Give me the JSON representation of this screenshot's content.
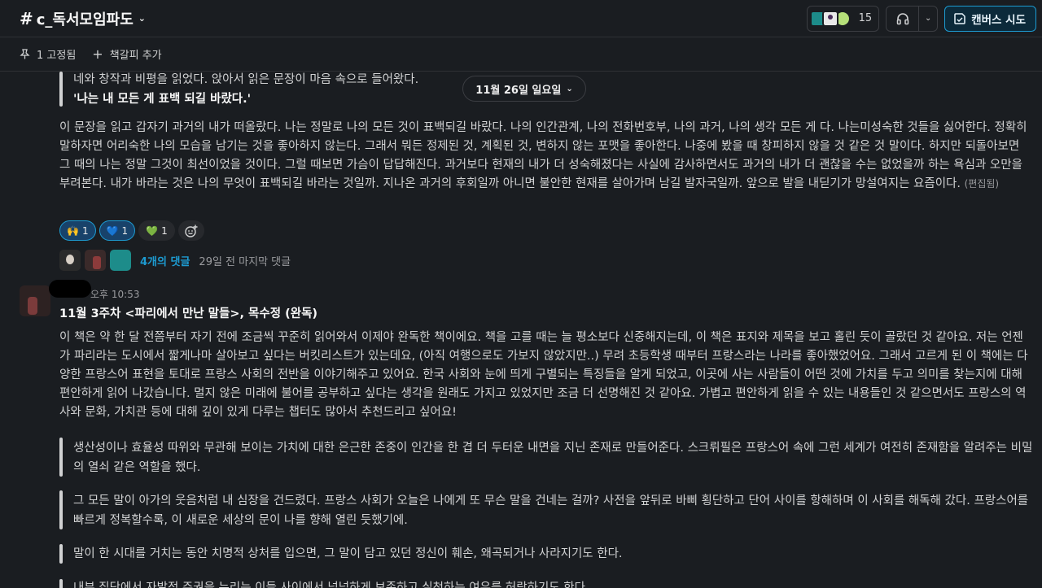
{
  "header": {
    "channel_prefix": "#",
    "channel_name": "c_독서모임파도",
    "member_count": "15",
    "canvas_button": "캔버스 시도"
  },
  "subbar": {
    "pinned": "1 고정됨",
    "add_bookmark": "책갈피 추가"
  },
  "date_divider": "11월 26일 일요일",
  "prev_message": {
    "quote_line1": "네와 창작과 비평을 읽었다. 앉아서 읽은 문장이 마음 속으로 들어왔다.",
    "quote_line2": "'나는 내 모든 게 표백 되길 바랐다.'",
    "body": "이 문장을 읽고 갑자기 과거의 내가 떠올랐다. 나는 정말로 나의 모든 것이 표백되길 바랐다. 나의 인간관계, 나의 전화번호부, 나의 과거, 나의 생각 모든 게 다. 나는미성숙한 것들을 싫어한다. 정확히 말하자면 어리숙한 나의 모습을 남기는 것을 좋아하지 않는다. 그래서 뭐든 정제된 것, 계획된 것, 변하지 않는 포맷을 좋아한다. 나중에 봤을 때 창피하지 않을 것 같은 것 말이다. 하지만 되돌아보면 그 때의 나는 정말 그것이 최선이었을 것이다.  그럴 때보면 가슴이 답답해진다. 과거보다 현재의 내가 더 성숙해졌다는 사실에 감사하면서도 과거의 내가 더 괜찮을 수는 없었을까 하는 욕심과 오만을 부려본다. 내가 바라는 것은 나의 무엇이 표백되길 바라는 것일까. 지나온 과거의 후회일까 아니면 불안한 현재를 살아가며 남길 발자국일까. 앞으로 발을 내딛기가 망설여지는 요즘이다.",
    "edited": "(편집됨)",
    "reactions": [
      {
        "emoji": "🙌",
        "count": "1",
        "selected": true
      },
      {
        "emoji": "💙",
        "count": "1",
        "selected": true
      },
      {
        "emoji": "💚",
        "count": "1",
        "selected": false
      }
    ],
    "thread": {
      "replies": "4개의 댓글",
      "last_reply": "29일 전 마지막 댓글"
    }
  },
  "message": {
    "time": "오후 10:53",
    "title": "11월 3주차 <파리에서 만난 말들>, 목수정 (완독)",
    "body": "이 책은 약 한 달 전쯤부터 자기 전에 조금씩 꾸준히 읽어와서 이제야 완독한 책이에요. 책을 고를 때는 늘 평소보다 신중해지는데, 이 책은 표지와 제목을 보고 홀린 듯이 골랐던 것 같아요. 저는 언젠가 파리라는 도시에서 짧게나마 살아보고 싶다는 버킷리스트가 있는데요, (아직 여행으로도 가보지 않았지만..) 무려 초등학생 때부터 프랑스라는 나라를 좋아했었어요. 그래서 고르게 된 이 책에는 다양한 프랑스어 표현을 토대로 프랑스 사회의 전반을 이야기해주고 있어요. 한국 사회와 눈에 띄게 구별되는 특징들을 알게 되었고, 이곳에 사는 사람들이 어떤 것에 가치를 두고 의미를 찾는지에 대해 편안하게 읽어 나갔습니다. 멀지 않은 미래에 불어를 공부하고 싶다는 생각을 원래도 가지고 있었지만 조금 더 선명해진 것 같아요. 가볍고 편안하게 읽을 수 있는 내용들인 것 같으면서도 프랑스의 역사와 문화, 가치관 등에 대해 깊이 있게 다루는 챕터도 많아서 추천드리고 싶어요!",
    "quotes": [
      "생산성이나 효율성 따위와 무관해 보이는 가치에 대한 은근한 존중이 인간을 한 겹 더 두터운 내면을 지닌 존재로 만들어준다. 스크뤼필은 프랑스어 속에 그런 세계가 여전히 존재함을 알려주는 비밀의 열쇠 같은 역할을 했다.",
      "그 모든 말이 아가의 웃음처럼 내 심장을 건드렸다. 프랑스 사회가 오늘은 나에게 또 무슨 말을 건네는 걸까? 사전을 앞뒤로 바삐 횡단하고 단어 사이를 항해하며 이 사회를 해독해 갔다. 프랑스어를 빠르게 정복할수록, 이 새로운 세상의 문이 나를 향해 열린 듯했기에.",
      "말이 한 시대를 거치는 동안 치명적 상처를 입으면, 그 말이 담고 있던 정신이 훼손, 왜곡되거나 사라지기도 한다.",
      "내부 집단에서 자발적 주권을 누리는 이들 사이에서 넉넉하게 보존하고 실천하는 여유를 허락하기도 한다."
    ]
  }
}
